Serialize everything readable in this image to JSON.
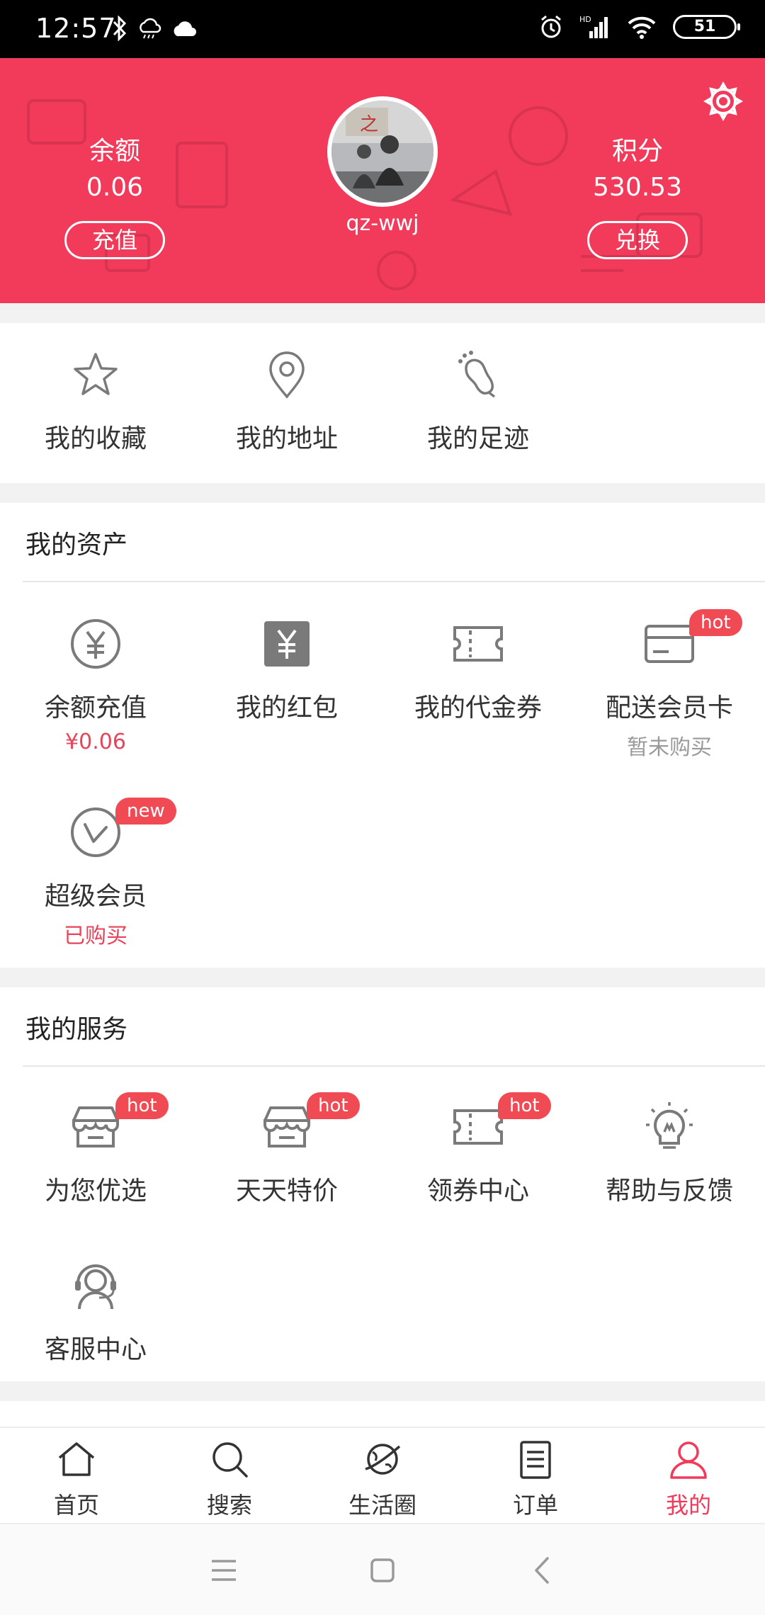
{
  "status_bar": {
    "time": "12:57",
    "battery": "51",
    "network": "HD"
  },
  "header": {
    "balance": {
      "label": "余额",
      "value": "0.06",
      "button": "充值"
    },
    "points": {
      "label": "积分",
      "value": "530.53",
      "button": "兑换"
    },
    "username": "qz-wwj",
    "colors": {
      "background": "#f23a5a"
    }
  },
  "quick_links": [
    {
      "label": "我的收藏",
      "icon": "star-icon"
    },
    {
      "label": "我的地址",
      "icon": "location-pin-icon"
    },
    {
      "label": "我的足迹",
      "icon": "footprint-icon"
    }
  ],
  "assets": {
    "title": "我的资产",
    "items": [
      {
        "label": "余额充值",
        "sub": "¥0.06",
        "icon": "yuan-circle-icon"
      },
      {
        "label": "我的红包",
        "sub": "",
        "icon": "red-packet-icon"
      },
      {
        "label": "我的代金券",
        "sub": "",
        "icon": "voucher-icon"
      },
      {
        "label": "配送会员卡",
        "sub": "暂未购买",
        "badge": "hot",
        "icon": "member-card-icon"
      },
      {
        "label": "超级会员",
        "sub": "已购买",
        "badge": "new",
        "icon": "super-member-icon"
      }
    ]
  },
  "services": {
    "title": "我的服务",
    "items": [
      {
        "label": "为您优选",
        "badge": "hot",
        "icon": "store-icon"
      },
      {
        "label": "天天特价",
        "badge": "hot",
        "icon": "store-icon"
      },
      {
        "label": "领券中心",
        "badge": "hot",
        "icon": "coupon-icon"
      },
      {
        "label": "帮助与反馈",
        "icon": "lightbulb-icon"
      },
      {
        "label": "客服中心",
        "icon": "customer-service-icon"
      }
    ]
  },
  "tabbar": [
    {
      "label": "首页",
      "icon": "home-icon"
    },
    {
      "label": "搜索",
      "icon": "search-icon"
    },
    {
      "label": "生活圈",
      "icon": "planet-icon"
    },
    {
      "label": "订单",
      "icon": "order-list-icon"
    },
    {
      "label": "我的",
      "icon": "user-icon",
      "active": true
    }
  ],
  "colors": {
    "accent": "#f23a5a",
    "badge": "#f04a55",
    "icon_gray": "#7a7a7a"
  }
}
